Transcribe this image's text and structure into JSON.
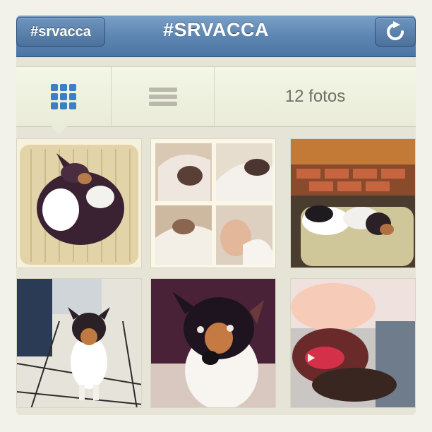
{
  "header": {
    "back_label": "#srvacca",
    "title": "#SRVACCA",
    "refresh_icon": "refresh-icon"
  },
  "toolbar": {
    "grid_icon": "grid-view-icon",
    "list_icon": "list-view-icon",
    "count_label": "12 fotos"
  },
  "photos": [
    {
      "subject": "dog-curled-on-cushion"
    },
    {
      "subject": "dog-collage-in-blankets"
    },
    {
      "subject": "dog-lying-on-pillow-by-fireplace"
    },
    {
      "subject": "dog-sitting-on-tiles"
    },
    {
      "subject": "dog-closeup-looking-up"
    },
    {
      "subject": "dog-yawning-blurry"
    }
  ],
  "colors": {
    "nav_blue": "#5d86b2",
    "toolbar_bg": "#eef0dd",
    "grid_icon_blue": "#3c7fc4"
  }
}
